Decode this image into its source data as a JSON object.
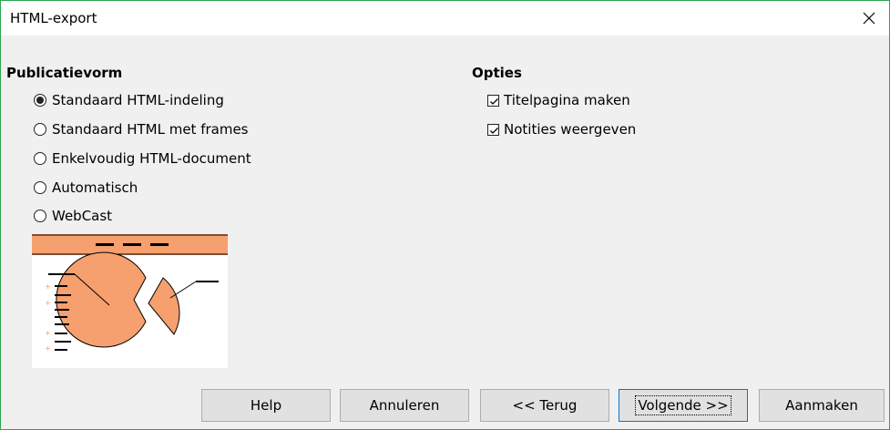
{
  "window": {
    "title": "HTML-export"
  },
  "publication": {
    "heading": "Publicatievorm",
    "options": [
      {
        "label": "Standaard HTML-indeling",
        "checked": true
      },
      {
        "label": "Standaard HTML met frames",
        "checked": false
      },
      {
        "label": "Enkelvoudig HTML-document",
        "checked": false
      },
      {
        "label": "Automatisch",
        "checked": false
      },
      {
        "label": "WebCast",
        "checked": false
      }
    ]
  },
  "options": {
    "heading": "Opties",
    "items": [
      {
        "label": "Titelpagina maken",
        "checked": true
      },
      {
        "label": "Notities weergeven",
        "checked": true
      }
    ]
  },
  "buttons": {
    "help": "Help",
    "cancel": "Annuleren",
    "back": "<< Terug",
    "next": "Volgende >>",
    "create": "Aanmaken"
  },
  "colors": {
    "window_border": "#2ea44f",
    "preview_orange": "#f5a06e",
    "default_button_border": "#0078d7"
  }
}
